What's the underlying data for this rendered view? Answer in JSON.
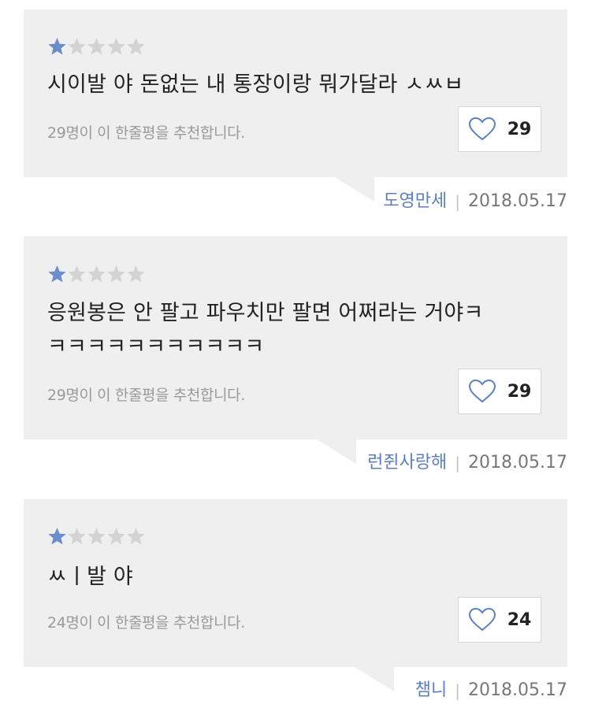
{
  "colors": {
    "card_bg": "#efefef",
    "star_filled": "#6a8dcc",
    "star_empty": "#d3d3d3",
    "author": "#5a7fc4",
    "heart": "#5a7fc4"
  },
  "icons": {
    "star": "star-icon",
    "like": "heart-outline-icon"
  },
  "reviews": [
    {
      "rating": 1,
      "max_rating": 5,
      "text": "시이발 야 돈없는 내 통장이랑 뭐가달라 ㅅㅆㅂ",
      "recommend_text": "29명이 이 한줄평을 추천합니다.",
      "likes": "29",
      "author": "도영만세",
      "separator": "|",
      "date": "2018.05.17"
    },
    {
      "rating": 1,
      "max_rating": 5,
      "text": "응원봉은 안 팔고 파우치만 팔면 어쩌라는 거야ㅋ\nㅋㅋㅋㅋㅋㅋㅋㅋㅋㅋㅋ",
      "recommend_text": "29명이 이 한줄평을 추천합니다.",
      "likes": "29",
      "author": "런쥔사랑해",
      "separator": "|",
      "date": "2018.05.17"
    },
    {
      "rating": 1,
      "max_rating": 5,
      "text": "ㅆㅣ발 야",
      "recommend_text": "24명이 이 한줄평을 추천합니다.",
      "likes": "24",
      "author": "챔니",
      "separator": "|",
      "date": "2018.05.17"
    }
  ]
}
